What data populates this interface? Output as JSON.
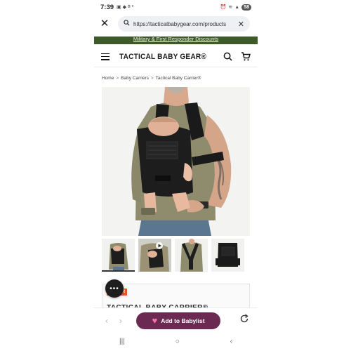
{
  "status_bar": {
    "time": "7:39",
    "left_icons": [
      "screenshot-icon",
      "shop-icon",
      "bluetooth-icon",
      "dot-icon"
    ],
    "right_icons": [
      "alarm-icon",
      "wifi-icon",
      "signal-icon"
    ],
    "battery": "58"
  },
  "browser": {
    "url": "https://tacticalbabygear.com/products",
    "close_label": "✕",
    "clear_label": "✕"
  },
  "promo": {
    "text": "Military & First Responder Discounts"
  },
  "header": {
    "logo": "TACTICAL BABY GEAR®"
  },
  "breadcrumb": {
    "items": [
      "Home",
      "Baby Carriers",
      "Tactical Baby Carrier®"
    ],
    "separator": ">"
  },
  "product": {
    "badge": "ER",
    "title": "TACTICAL BABY CARRIER®",
    "thumbnail_count": 4
  },
  "chat": {
    "label": "•••"
  },
  "bottom_bar": {
    "back": "‹",
    "forward": "›",
    "babylist_label": "Add to Babylist"
  },
  "system_nav": {
    "recents": "|||",
    "home": "○",
    "back": "‹"
  },
  "colors": {
    "promo_bg": "#3f5a2a",
    "babylist_bg": "#6a2a52",
    "badge_bg": "#e2582a",
    "heart": "#ff6fa8"
  }
}
